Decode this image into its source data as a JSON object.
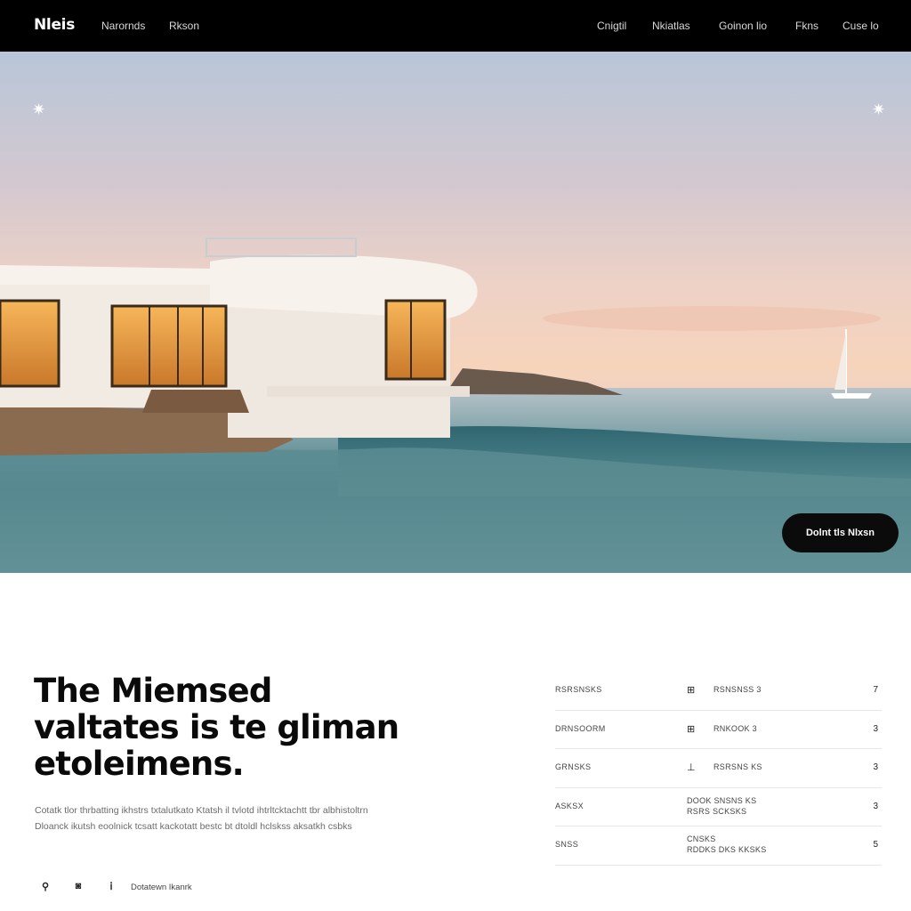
{
  "nav": {
    "brand": "Nleis",
    "left_links": [
      "Narornds",
      "Rkson"
    ],
    "right_links": [
      "Cnigtil",
      "Nkiatlas",
      "Goinon lio",
      "Fkns",
      "Cuse lo"
    ]
  },
  "hero": {
    "cta_label": "Dolnt tls Nlxsn",
    "colors": {
      "cta_bg": "#0b0b0b",
      "nav_bg": "#000000"
    }
  },
  "content": {
    "headline_lines": [
      "The Miemsed",
      "valtates is te gliman",
      "etoleimens."
    ],
    "body_lines": [
      "Cotatk tlor thrbatting ikhstrs txtalutkato Ktatsh il tvlotd ihtrltcktachtt tbr albhistoltrn",
      "Dloanck ikutsh eoolnick tcsatt kackotatt bestc bt dtoldl hclskss aksatkh csbks"
    ],
    "footer_icons": [
      "pin-icon",
      "camera-icon",
      "info-icon"
    ],
    "footer_label": "Dotatewn Ikanrk"
  },
  "specs": [
    {
      "key": "RSRSNSKS",
      "icon": "grid-icon",
      "value": "RSNSNSS 3",
      "num": "7"
    },
    {
      "key": "DRNSOORM",
      "icon": "grid-icon",
      "value": "RNKOOK 3",
      "num": "3"
    },
    {
      "key": "GRNSKS",
      "icon": "ruler-icon",
      "value": "RSRSNS KS",
      "num": "3"
    },
    {
      "key": "ASKSX",
      "icon": "",
      "value": "DOOK SNSNS KS / RSRS SCKSKS",
      "num": "3"
    },
    {
      "key": "SNSS",
      "icon": "",
      "value": "CNSKS / RDDKS DKS KKSKS",
      "num": "5"
    }
  ]
}
